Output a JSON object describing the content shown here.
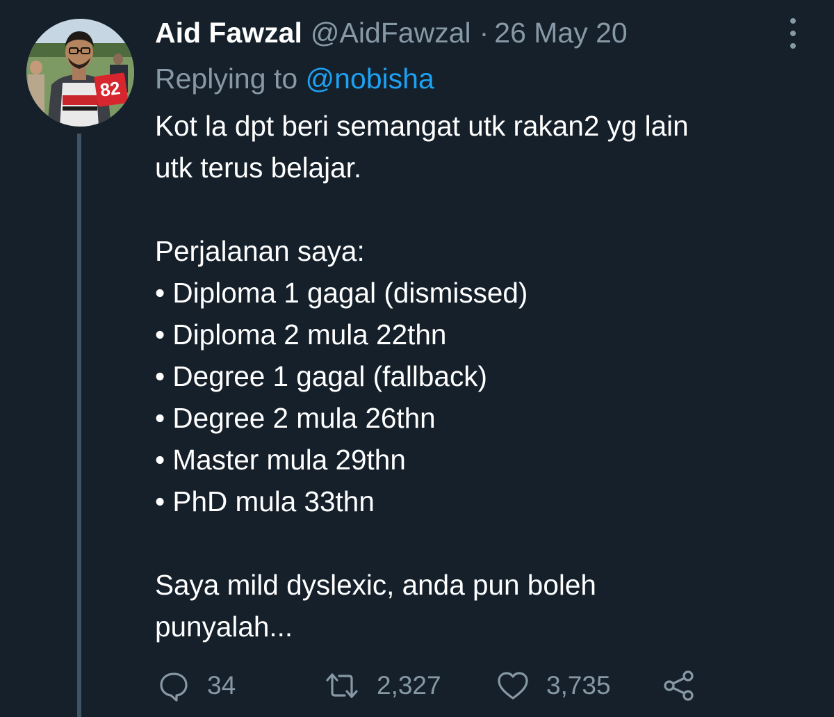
{
  "tweet": {
    "author_name": "Aid Fawzal",
    "author_handle": "@AidFawzal",
    "separator": "·",
    "date": "26 May 20",
    "replying_prefix": "Replying to ",
    "replying_to": "@nobisha",
    "avatar_badge_number": "82",
    "body_lines": {
      "intro_1": "Kot la dpt beri semangat utk rakan2 yg lain",
      "intro_2": "utk terus belajar.",
      "journey_title": "Perjalanan saya:",
      "items": [
        "• Diploma 1 gagal (dismissed)",
        "• Diploma 2 mula 22thn",
        "• Degree 1 gagal (fallback)",
        "• Degree 2 mula 26thn",
        "• Master mula 29thn",
        "• PhD mula 33thn"
      ],
      "closing_1": "Saya mild dyslexic, anda pun boleh",
      "closing_2": "punyalah..."
    },
    "counts": {
      "replies": "34",
      "retweets": "2,327",
      "likes": "3,735"
    }
  },
  "icons": {
    "more": "more-vertical-icon",
    "reply": "reply-bubble-icon",
    "retweet": "retweet-icon",
    "like": "heart-icon",
    "share": "share-icon"
  },
  "colors": {
    "background": "#15202b",
    "primary_text": "#ffffff",
    "secondary_text": "#8899a6",
    "accent": "#1da1f2",
    "thread_line": "#3d5466"
  }
}
